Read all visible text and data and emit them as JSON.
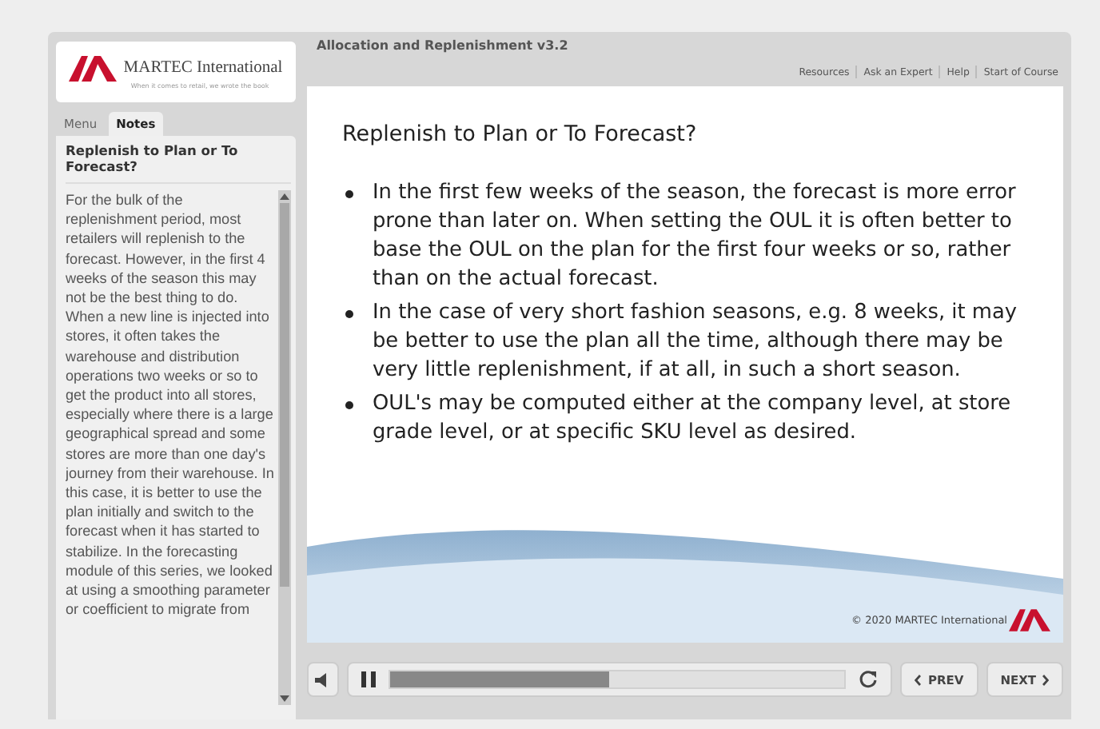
{
  "logo": {
    "name": "MARTEC International",
    "tagline": "When it comes to retail, we wrote the book"
  },
  "tabs": [
    {
      "label": "Menu",
      "selected": false
    },
    {
      "label": "Notes",
      "selected": true
    }
  ],
  "notes": {
    "title": "Replenish to Plan or To Forecast?",
    "text": "For the bulk of the replenishment period, most retailers will replenish to the forecast.  However, in the first 4 weeks of the season this may not be the best thing to do.  When a new line is injected into stores, it often takes the warehouse and distribution operations two weeks or so to get the product into all stores, especially where there is a large geographical spread and some stores are more than one day's journey from their warehouse.  In this case, it is better to use the plan initially and switch to the forecast when it has started to stabilize.  In the forecasting module of this series, we looked at using a smoothing parameter or coefficient to migrate from"
  },
  "course_title": "Allocation and Replenishment v3.2",
  "top_links": [
    "Resources",
    "Ask an Expert",
    "Help",
    "Start of Course"
  ],
  "slide": {
    "title": "Replenish to Plan or To Forecast?",
    "bullets": [
      "In the first few weeks of the season, the forecast is more error prone than later on.  When setting the OUL it is often better to base the OUL on the plan for the first four weeks  or so, rather than on the actual forecast.",
      "In the case of very short fashion seasons, e.g. 8 weeks, it may be better to use the plan all the time, although there may be very little replenishment, if at all, in such a short season.",
      "OUL's may be computed either at the company level, at store grade level, or  at specific SKU level as desired."
    ],
    "copyright": "© 2020 MARTEC International"
  },
  "player": {
    "level": 0.48,
    "prev": "PREV",
    "next": "NEXT"
  }
}
